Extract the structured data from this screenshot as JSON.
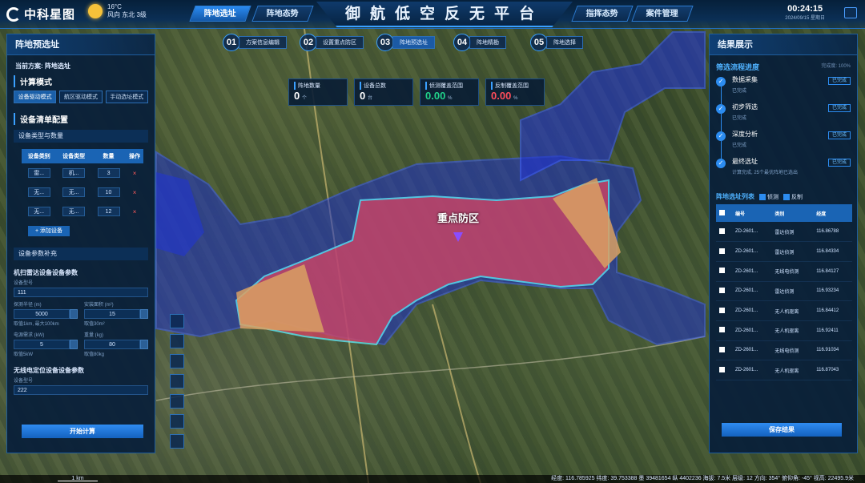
{
  "header": {
    "logo": "中科星图",
    "weather": {
      "temp": "16°C",
      "desc": "风向 东北 3级"
    },
    "nav_left": [
      "阵地选址",
      "阵地态势"
    ],
    "title": "御航低空反无平台",
    "nav_right": [
      "指挥态势",
      "案件管理"
    ],
    "clock": {
      "time": "00:24:15",
      "date": "2024/09/15 星期日"
    }
  },
  "left_panel": {
    "title": "阵地预选址",
    "plan": "当前方案: 阵地选址",
    "calc_mode_title": "计算模式",
    "modes": [
      "设备驱动模式",
      "航区驱动模式",
      "手动选址模式"
    ],
    "device_config_title": "设备清单配置",
    "device_type_qty": "设备类型与数量",
    "table_headers": [
      "设备类别",
      "设备类型",
      "数量",
      "操作"
    ],
    "rows": [
      {
        "cat": "雷...",
        "type": "机...",
        "qty": "3",
        "op": "×"
      },
      {
        "cat": "无...",
        "type": "无...",
        "qty": "10",
        "op": "×"
      },
      {
        "cat": "无...",
        "type": "无...",
        "qty": "12",
        "op": "×"
      }
    ],
    "add_device": "+ 添加设备",
    "param_sup": "设备参数补充",
    "radar_title": "机扫雷达设备设备参数",
    "model_label": "设备型号",
    "model_value": "111",
    "range_label": "探测半径 (m)",
    "range_value": "5000",
    "range_hint": "取值1km, 最大100km",
    "area_label": "安装面积 (m²)",
    "area_value": "15",
    "area_hint": "取值30m²",
    "power_label": "电源需求 (kW)",
    "power_value": "5",
    "power_hint": "取值5kW",
    "weight_label": "重量 (kg)",
    "weight_value": "80",
    "weight_hint": "取值80kg",
    "wireless_title": "无线电定位设备设备参数",
    "model2_label": "设备型号",
    "model2_value": "222",
    "start_btn": "开始计算"
  },
  "steps": [
    {
      "n": "01",
      "label": "方案信息编辑"
    },
    {
      "n": "02",
      "label": "设置重点防区"
    },
    {
      "n": "03",
      "label": "阵地预选址"
    },
    {
      "n": "04",
      "label": "阵地精勘"
    },
    {
      "n": "05",
      "label": "阵地选择"
    }
  ],
  "stats": [
    {
      "label": "阵地数量",
      "value": "0",
      "unit": "个",
      "color": "#3aa0ff"
    },
    {
      "label": "设备总数",
      "value": "0",
      "unit": "台",
      "color": "#3aa0ff"
    },
    {
      "label": "侦测覆盖范围",
      "value": "0.00",
      "unit": "%",
      "color": "#21d28a"
    },
    {
      "label": "反制覆盖范围",
      "value": "0.00",
      "unit": "%",
      "color": "#ff4d5a"
    }
  ],
  "map": {
    "zone_label": "重点防区"
  },
  "right_panel": {
    "title": "结果展示",
    "progress_title": "筛选流程进度",
    "progress_meta": "完成度: 100%",
    "steps": [
      {
        "title": "数据采集",
        "desc": "已完成",
        "tag": "已完成"
      },
      {
        "title": "初步筛选",
        "desc": "已完成",
        "tag": "已完成"
      },
      {
        "title": "深度分析",
        "desc": "已完成",
        "tag": "已完成"
      },
      {
        "title": "最终选址",
        "desc": "计算完成, 25个最优阵地已选出",
        "tag": "已完成"
      }
    ],
    "list_title": "阵地选址列表",
    "filter_detect": "侦测",
    "filter_counter": "反制",
    "headers": [
      "编号",
      "类别",
      "经度"
    ],
    "rows": [
      {
        "id": "ZD-2601...",
        "cat": "雷达侦测",
        "lng": "116.86788"
      },
      {
        "id": "ZD-2601...",
        "cat": "雷达侦测",
        "lng": "116.84334"
      },
      {
        "id": "ZD-2601...",
        "cat": "无线电侦测",
        "lng": "116.84127"
      },
      {
        "id": "ZD-2601...",
        "cat": "雷达侦测",
        "lng": "116.93234"
      },
      {
        "id": "ZD-2601...",
        "cat": "无人机驱离",
        "lng": "116.84412"
      },
      {
        "id": "ZD-2601...",
        "cat": "无人机驱离",
        "lng": "116.92411"
      },
      {
        "id": "ZD-2601...",
        "cat": "无线电侦测",
        "lng": "116.91034"
      },
      {
        "id": "ZD-2601...",
        "cat": "无人机驱离",
        "lng": "116.87043"
      }
    ],
    "save_btn": "保存结果"
  },
  "status": {
    "scale": "1 km",
    "coords": "经度: 116.785925  纬度: 39.753388  墨 39481654 纵 4402236  海拔: 7.5米  层级: 12  方向: 354°  俯仰角: -45°  视高: 22495.9米"
  }
}
